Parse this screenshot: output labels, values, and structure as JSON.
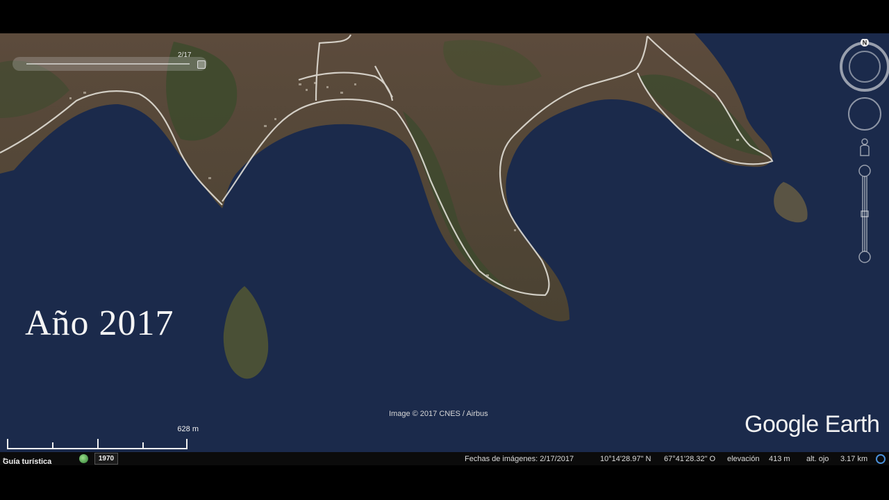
{
  "time_slider": {
    "date_label": "2/17"
  },
  "overlay": {
    "year_title": "Año 2017"
  },
  "navigation": {
    "north_label": "N"
  },
  "imagery_credit": "Image © 2017 CNES / Airbus",
  "logo": "Google Earth",
  "scale_bar": {
    "label": "628 m"
  },
  "status_bar": {
    "tour_guide": "Guía turística",
    "historical_year": "1970",
    "imagery_date": "Fechas de imágenes: 2/17/2017",
    "latitude": "10°14'28.97\" N",
    "longitude": "67°41'28.32\" O",
    "elevation_label": "elevación",
    "elevation_value": "413 m",
    "eye_alt_label": "alt. ojo",
    "eye_alt_value": "3.17 km"
  },
  "colors": {
    "water": "#1b2a4b",
    "land": "#5a4c3c",
    "vegetation": "#3e4a2e",
    "road": "#e9e6de"
  }
}
